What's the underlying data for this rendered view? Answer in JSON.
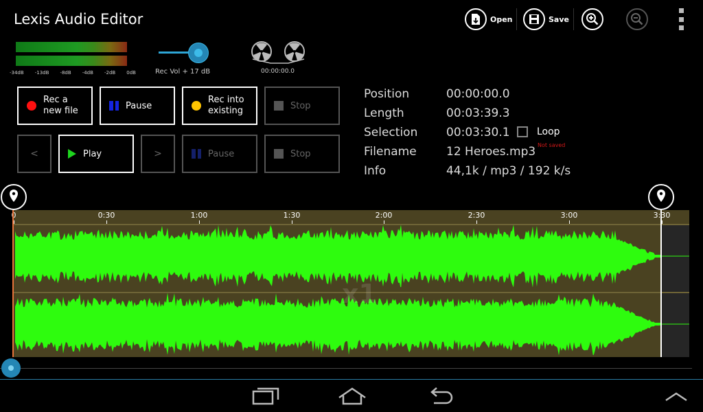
{
  "app": {
    "title": "Lexis Audio Editor"
  },
  "toolbar": {
    "open_label": "Open",
    "save_label": "Save",
    "icons": [
      "open-file-icon",
      "save-icon",
      "zoom-in-icon",
      "zoom-out-icon",
      "overflow-menu-icon"
    ]
  },
  "meters": {
    "scale": [
      "-34dB",
      "-13dB",
      "-8dB",
      "-4dB",
      "-2dB",
      "0dB"
    ]
  },
  "record_volume": {
    "label": "Rec Vol + 17 dB"
  },
  "reels": {
    "time": "00:00:00.0"
  },
  "buttons": {
    "rec_new": "Rec a\nnew file",
    "pause_top": "Pause",
    "rec_existing": "Rec into\nexisting",
    "stop_top": "Stop",
    "prev": "<",
    "play": "Play",
    "next": ">",
    "pause_bottom": "Pause",
    "stop_bottom": "Stop"
  },
  "info": {
    "position_label": "Position",
    "position_value": "00:00:00.0",
    "length_label": "Length",
    "length_value": "00:03:39.3",
    "selection_label": "Selection",
    "selection_value": "00:03:30.1",
    "loop_label": "Loop",
    "loop_checked": false,
    "filename_label": "Filename",
    "filename_value": "12 Heroes.mp3",
    "not_saved": "Not saved",
    "info_label": "Info",
    "info_value": "44,1k / mp3 / 192 k/s"
  },
  "timeline": {
    "labels": [
      "0",
      "0:30",
      "1:00",
      "1:30",
      "2:00",
      "2:30",
      "3:00",
      "3:30"
    ]
  },
  "waveform": {
    "watermark": "x1"
  },
  "colors": {
    "wave": "#2efc0e",
    "wave_bg": "#4a4221",
    "accent": "#2ea6d6",
    "rec": "#ff1010",
    "rec_existing": "#ffc400",
    "pause": "#1424e0",
    "play": "#1ed41e"
  }
}
